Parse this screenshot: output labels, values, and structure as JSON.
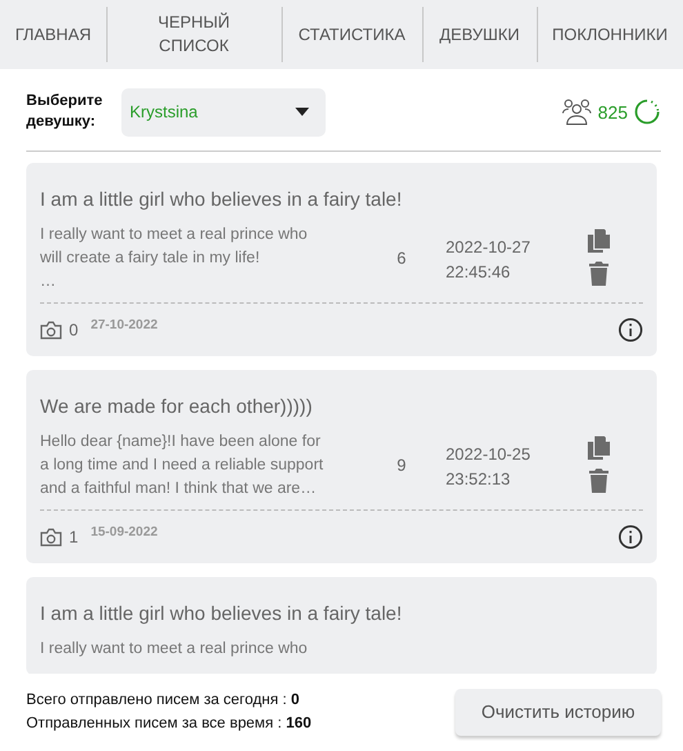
{
  "tabs": [
    {
      "label": "ГЛАВНАЯ",
      "selected": false
    },
    {
      "label": "ЧЕРНЫЙ\nСПИСОК",
      "selected": false
    },
    {
      "label": "СТАТИСТИКА",
      "selected": false
    },
    {
      "label": "ДЕВУШКИ",
      "selected": false
    },
    {
      "label": "ПОКЛОННИКИ",
      "selected": false
    }
  ],
  "girl_select": {
    "label": "Выберите девушку:",
    "value": "Krystsina"
  },
  "fans": {
    "count": "825"
  },
  "letters": [
    {
      "title": "I am a little girl who believes in a fairy tale!",
      "body": "I really want to meet a real prince who\nwill create a fairy tale in my life!\n…",
      "count": "6",
      "sent_date": "2022-10-27",
      "sent_time": "22:45:46",
      "photos": "0",
      "created": "27-10-2022"
    },
    {
      "title": "We are made for each other)))))",
      "body": "Hello dear {name}!I have been alone for\na long time and I need a reliable support\nand a faithful man! I think that we are…",
      "count": "9",
      "sent_date": "2022-10-25",
      "sent_time": "23:52:13",
      "photos": "1",
      "created": "15-09-2022"
    },
    {
      "title": "I am a little girl who believes in a fairy tale!",
      "body": "I really want to meet a real prince who"
    }
  ],
  "stats": [
    "Всего отправлено писем за сегодня : **0**",
    "Отправленных писем за все время : **160**"
  ],
  "clear_button": "Очистить историю"
}
